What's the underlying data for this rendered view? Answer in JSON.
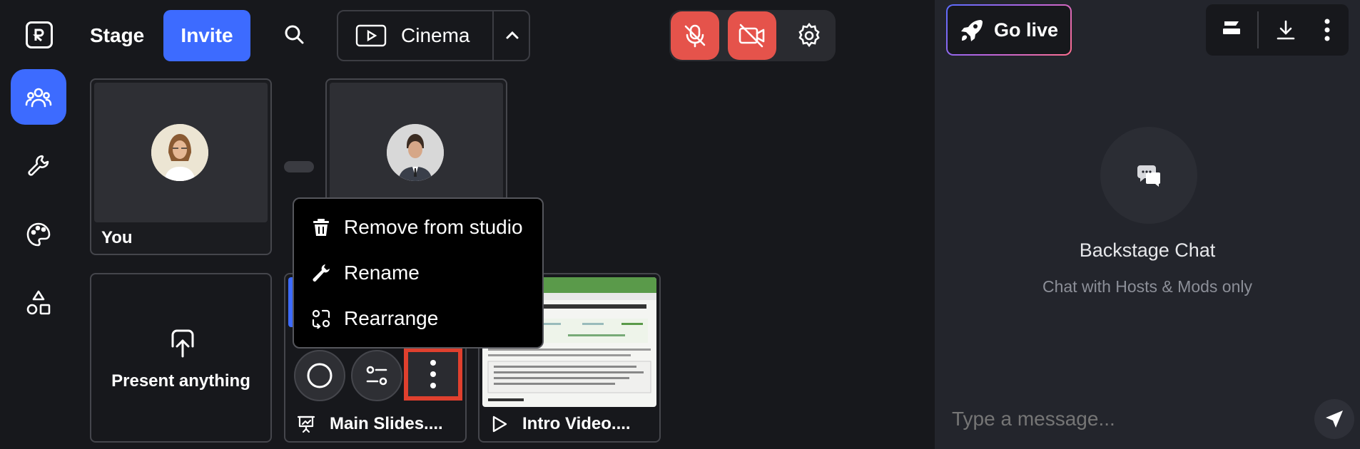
{
  "topbar": {
    "stage_label": "Stage",
    "invite_label": "Invite",
    "layout_label": "Cinema"
  },
  "tiles": {
    "you_label": "You",
    "present_label": "Present anything",
    "slides_label": "Main Slides....",
    "video_label": "Intro Video...."
  },
  "context_menu": {
    "items": [
      "Remove from studio",
      "Rename",
      "Rearrange"
    ]
  },
  "right_panel": {
    "golive_label": "Go live",
    "chat_title": "Backstage Chat",
    "chat_subtitle": "Chat with Hosts & Mods only",
    "message_placeholder": "Type a message..."
  },
  "colors": {
    "accent": "#3d6bff",
    "danger": "#e5534b",
    "highlight": "#e0402e"
  },
  "icons": {
    "rail": [
      "people-icon",
      "wrench-icon",
      "palette-icon",
      "shapes-icon"
    ],
    "media": [
      "mic-off-icon",
      "camera-off-icon",
      "gear-icon"
    ]
  }
}
